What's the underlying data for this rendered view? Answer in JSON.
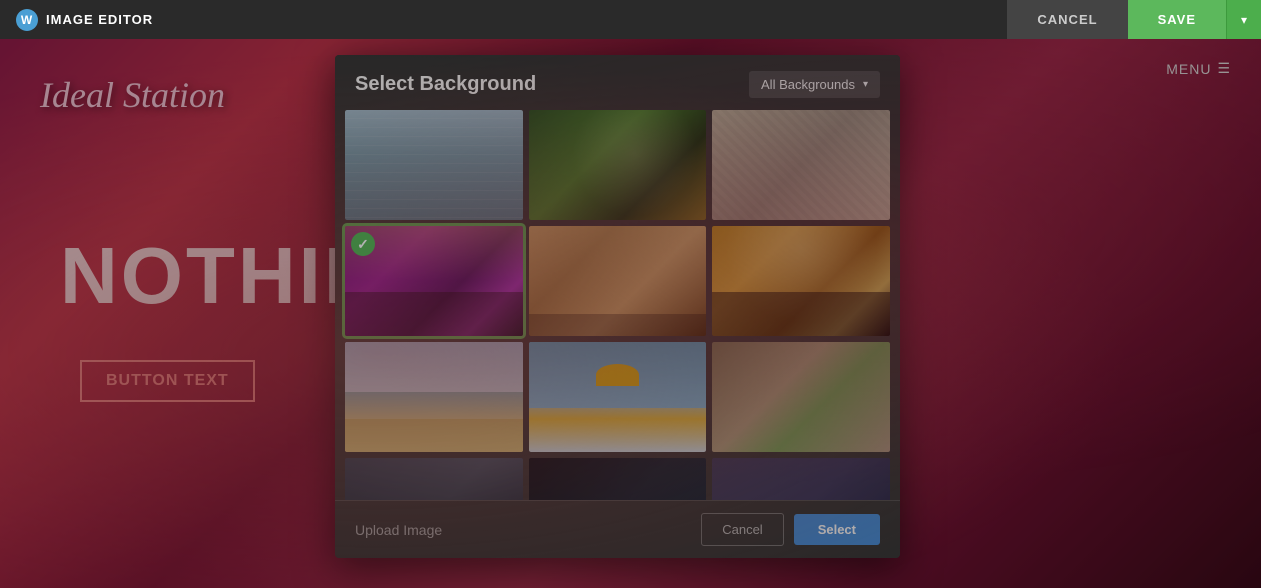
{
  "topbar": {
    "logo_text": "IMAGE EDITOR",
    "cancel_label": "CANCEL",
    "save_label": "SAVE"
  },
  "page": {
    "site_title": "Ideal Station",
    "menu_label": "MENU",
    "nothing_text": "NOTHING",
    "button_label": "BUTTON TEXT"
  },
  "modal": {
    "title": "Select Background",
    "dropdown_label": "All Backgrounds",
    "upload_label": "Upload Image",
    "cancel_label": "Cancel",
    "select_label": "Select",
    "thumbnails": [
      {
        "id": 1,
        "type": "water",
        "selected": false,
        "row": 1
      },
      {
        "id": 2,
        "type": "flower",
        "selected": false,
        "row": 1
      },
      {
        "id": 3,
        "type": "texture",
        "selected": false,
        "row": 1
      },
      {
        "id": 4,
        "type": "concert-purple",
        "selected": true,
        "row": 2
      },
      {
        "id": 5,
        "type": "hands",
        "selected": false,
        "row": 2
      },
      {
        "id": 6,
        "type": "concert-gold",
        "selected": false,
        "row": 2
      },
      {
        "id": 7,
        "type": "beach-chairs",
        "selected": false,
        "row": 3
      },
      {
        "id": 8,
        "type": "yellow-umbrella",
        "selected": false,
        "row": 3
      },
      {
        "id": 9,
        "type": "couple",
        "selected": false,
        "row": 3
      },
      {
        "id": 10,
        "type": "dark1",
        "selected": false,
        "row": 4
      },
      {
        "id": 11,
        "type": "dark2",
        "selected": false,
        "row": 4
      },
      {
        "id": 12,
        "type": "dark3",
        "selected": false,
        "row": 4
      }
    ]
  }
}
